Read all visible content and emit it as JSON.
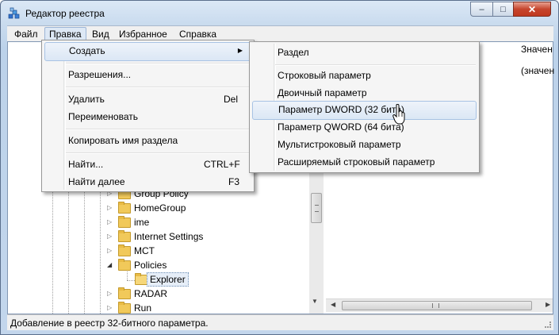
{
  "window": {
    "title": "Редактор реестра",
    "icon": "regedit-icon",
    "buttons": {
      "minimize": "–",
      "maximize": "□",
      "close": "✕"
    }
  },
  "menubar": {
    "items": [
      "Файл",
      "Правка",
      "Вид",
      "Избранное",
      "Справка"
    ],
    "active": "Правка"
  },
  "edit_menu": {
    "create": "Создать",
    "permissions": "Разрешения...",
    "delete": "Удалить",
    "delete_shortcut": "Del",
    "rename": "Переименовать",
    "copy_key_name": "Копировать имя раздела",
    "find": "Найти...",
    "find_shortcut": "CTRL+F",
    "find_next": "Найти далее",
    "find_next_shortcut": "F3"
  },
  "create_submenu": {
    "items": [
      "Раздел",
      "Строковый параметр",
      "Двоичный параметр",
      "Параметр DWORD (32 бита)",
      "Параметр QWORD (64 бита)",
      "Мультистроковый параметр",
      "Расширяемый строковый параметр"
    ],
    "highlighted": "Параметр DWORD (32 бита)"
  },
  "tree": {
    "nodes": [
      "Group Policy",
      "HomeGroup",
      "ime",
      "Internet Settings",
      "MCT",
      "Policies",
      "Explorer",
      "RADAR",
      "Run"
    ],
    "selected": "Explorer"
  },
  "list": {
    "column_value": "Значен",
    "default_value": "(значен"
  },
  "statusbar": {
    "text": "Добавление в реестр 32-битного параметра."
  }
}
